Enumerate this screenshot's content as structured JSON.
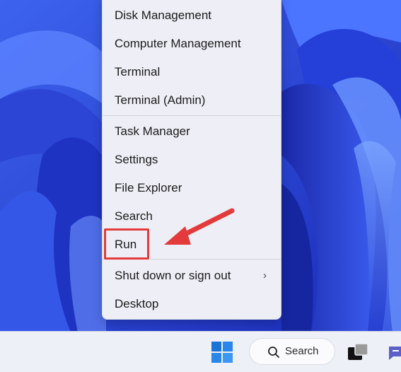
{
  "menu": {
    "items": [
      {
        "label": "Disk Management"
      },
      {
        "label": "Computer Management"
      },
      {
        "label": "Terminal"
      },
      {
        "label": "Terminal (Admin)"
      },
      {
        "label": "Task Manager"
      },
      {
        "label": "Settings"
      },
      {
        "label": "File Explorer"
      },
      {
        "label": "Search"
      },
      {
        "label": "Run"
      },
      {
        "label": "Shut down or sign out",
        "chevron": "›"
      },
      {
        "label": "Desktop"
      }
    ]
  },
  "taskbar": {
    "start_icon": "windows-logo-icon",
    "search_label": "Search",
    "search_icon": "search-icon",
    "taskview_icon": "task-view-icon",
    "chat_icon": "chat-icon"
  },
  "annotation": {
    "highlight_color": "#e33b3b",
    "highlight_target": "Run"
  },
  "colors": {
    "wallpaper_base": "#2f4fe0",
    "menu_bg": "#eeeff6",
    "taskbar_bg": "#eef0f8",
    "windows_logo": "#1a73d9"
  }
}
